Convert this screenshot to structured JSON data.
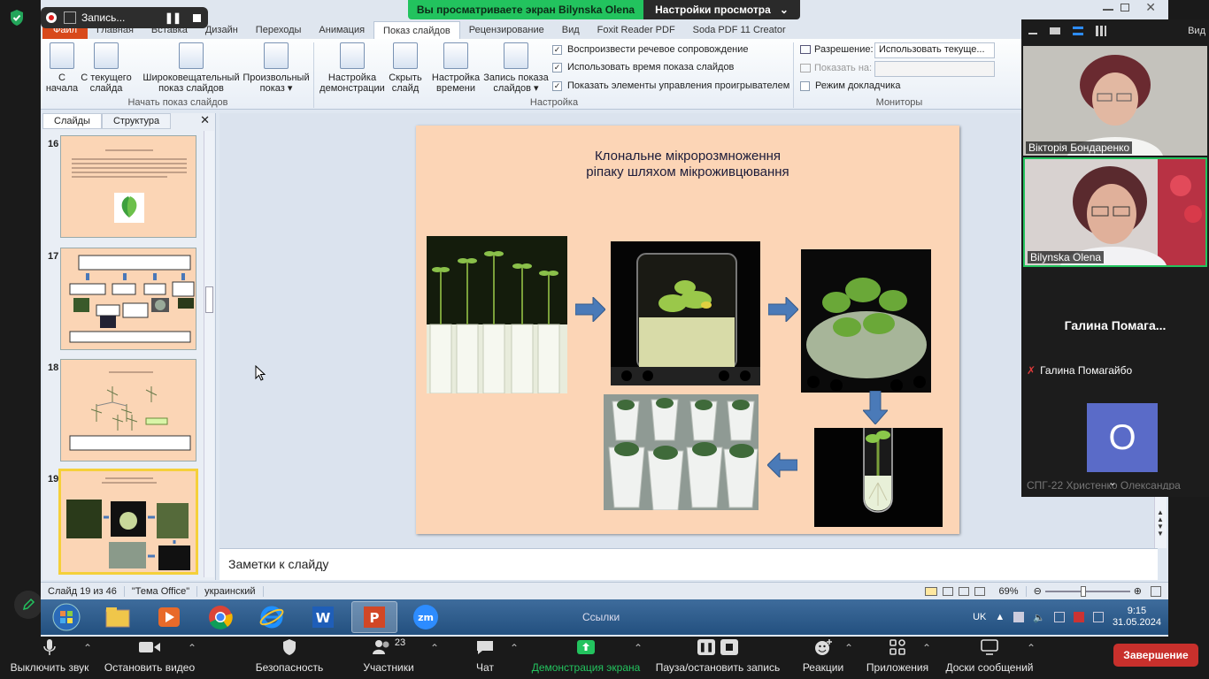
{
  "zoom": {
    "recording_label": "Запись...",
    "share_notice": "Вы просматриваете экран Bilynska Olena",
    "view_settings": "Настройки просмотра",
    "view_label": "Вид",
    "end_label": "Завершение",
    "toolbar": {
      "mute": "Выключить звук",
      "stop_video": "Остановить видео",
      "security": "Безопасность",
      "participants": "Участники",
      "participants_count": "23",
      "chat": "Чат",
      "share": "Демонстрация экрана",
      "pause_record": "Пауза/остановить запись",
      "reactions": "Реакции",
      "apps": "Приложения",
      "boards": "Доски сообщений"
    },
    "gallery": [
      {
        "name": "Вікторія Бондаренко"
      },
      {
        "name": "Bilynska Olena"
      },
      {
        "name": "Галина Помагайбо",
        "big_name": "Галина  Помага..."
      },
      {
        "name": "СПГ-22 Христенко Олександра",
        "initial": "O"
      }
    ]
  },
  "ppt": {
    "tabs": [
      "Файл",
      "Главная",
      "Вставка",
      "Дизайн",
      "Переходы",
      "Анимация",
      "Показ слайдов",
      "Рецензирование",
      "Вид",
      "Foxit Reader PDF",
      "Soda PDF 11 Creator"
    ],
    "active_tab": "Показ слайдов",
    "ribbon": {
      "start_group": "Начать показ слайдов",
      "setup_group": "Настройка",
      "monitors_group": "Мониторы",
      "btn_from_start": [
        "С",
        "начала"
      ],
      "btn_from_current": [
        "С текущего",
        "слайда"
      ],
      "btn_broadcast": [
        "Широковещательный",
        "показ слайдов"
      ],
      "btn_custom": [
        "Произвольный",
        "показ ▾"
      ],
      "btn_setup": [
        "Настройка",
        "демонстрации"
      ],
      "btn_hide": [
        "Скрыть",
        "слайд"
      ],
      "btn_timing": [
        "Настройка",
        "времени"
      ],
      "btn_record": [
        "Запись показа",
        "слайдов ▾"
      ],
      "chk_narration": "Воспроизвести речевое сопровождение",
      "chk_timings": "Использовать время показа слайдов",
      "chk_controls": "Показать элементы управления проигрывателем",
      "resolution_label": "Разрешение:",
      "resolution_value": "Использовать текуще...",
      "show_on_label": "Показать на:",
      "presenter_view": "Режим докладчика"
    },
    "panel_tabs": [
      "Слайды",
      "Структура"
    ],
    "thumbs": [
      {
        "no": "16"
      },
      {
        "no": "17"
      },
      {
        "no": "18"
      },
      {
        "no": "19"
      }
    ],
    "slide_title_line1": "Клональне мікророзмноження",
    "slide_title_line2": "ріпаку шляхом мікроживцювання",
    "notes_placeholder": "Заметки к слайду",
    "status": {
      "slide_info": "Слайд 19 из 46",
      "theme": "\"Тема Office\"",
      "language": "украинский",
      "zoom": "69%"
    }
  },
  "taskbar": {
    "links": "Ссылки",
    "lang": "UK",
    "time": "9:15",
    "date": "31.05.2024"
  }
}
